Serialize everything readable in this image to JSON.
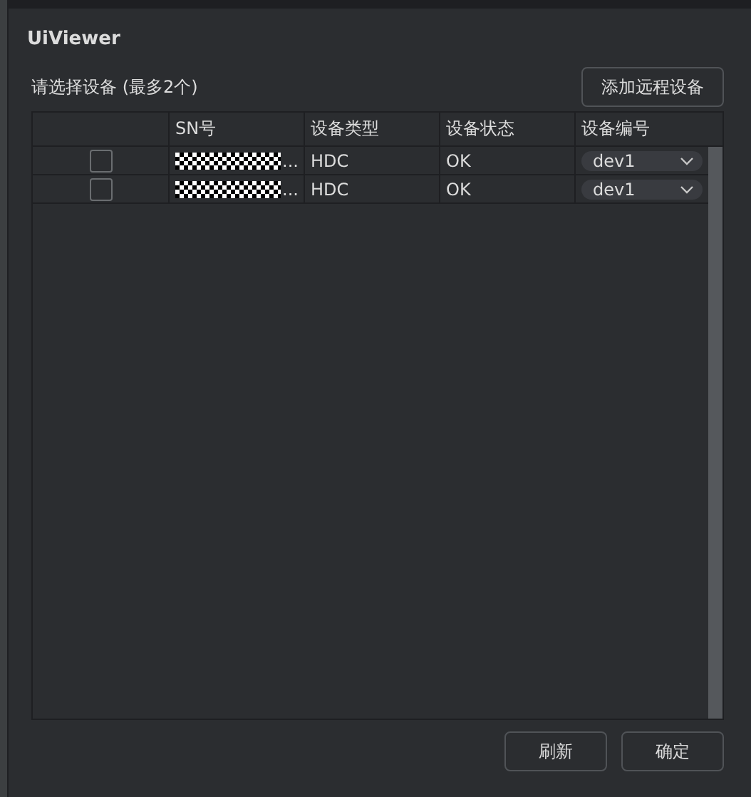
{
  "window": {
    "title": "UiViewer"
  },
  "prompt": "请选择设备 (最多2个)",
  "add_button": "添加远程设备",
  "table": {
    "columns": [
      "SN号",
      "设备类型",
      "设备状态",
      "设备编号"
    ],
    "rows": [
      {
        "checked": false,
        "sn_tail": "...",
        "type": "HDC",
        "status": "OK",
        "device": "dev1"
      },
      {
        "checked": false,
        "sn_tail": "...",
        "type": "HDC",
        "status": "OK",
        "device": "dev1"
      }
    ]
  },
  "buttons": [
    "刷新",
    "确定"
  ]
}
